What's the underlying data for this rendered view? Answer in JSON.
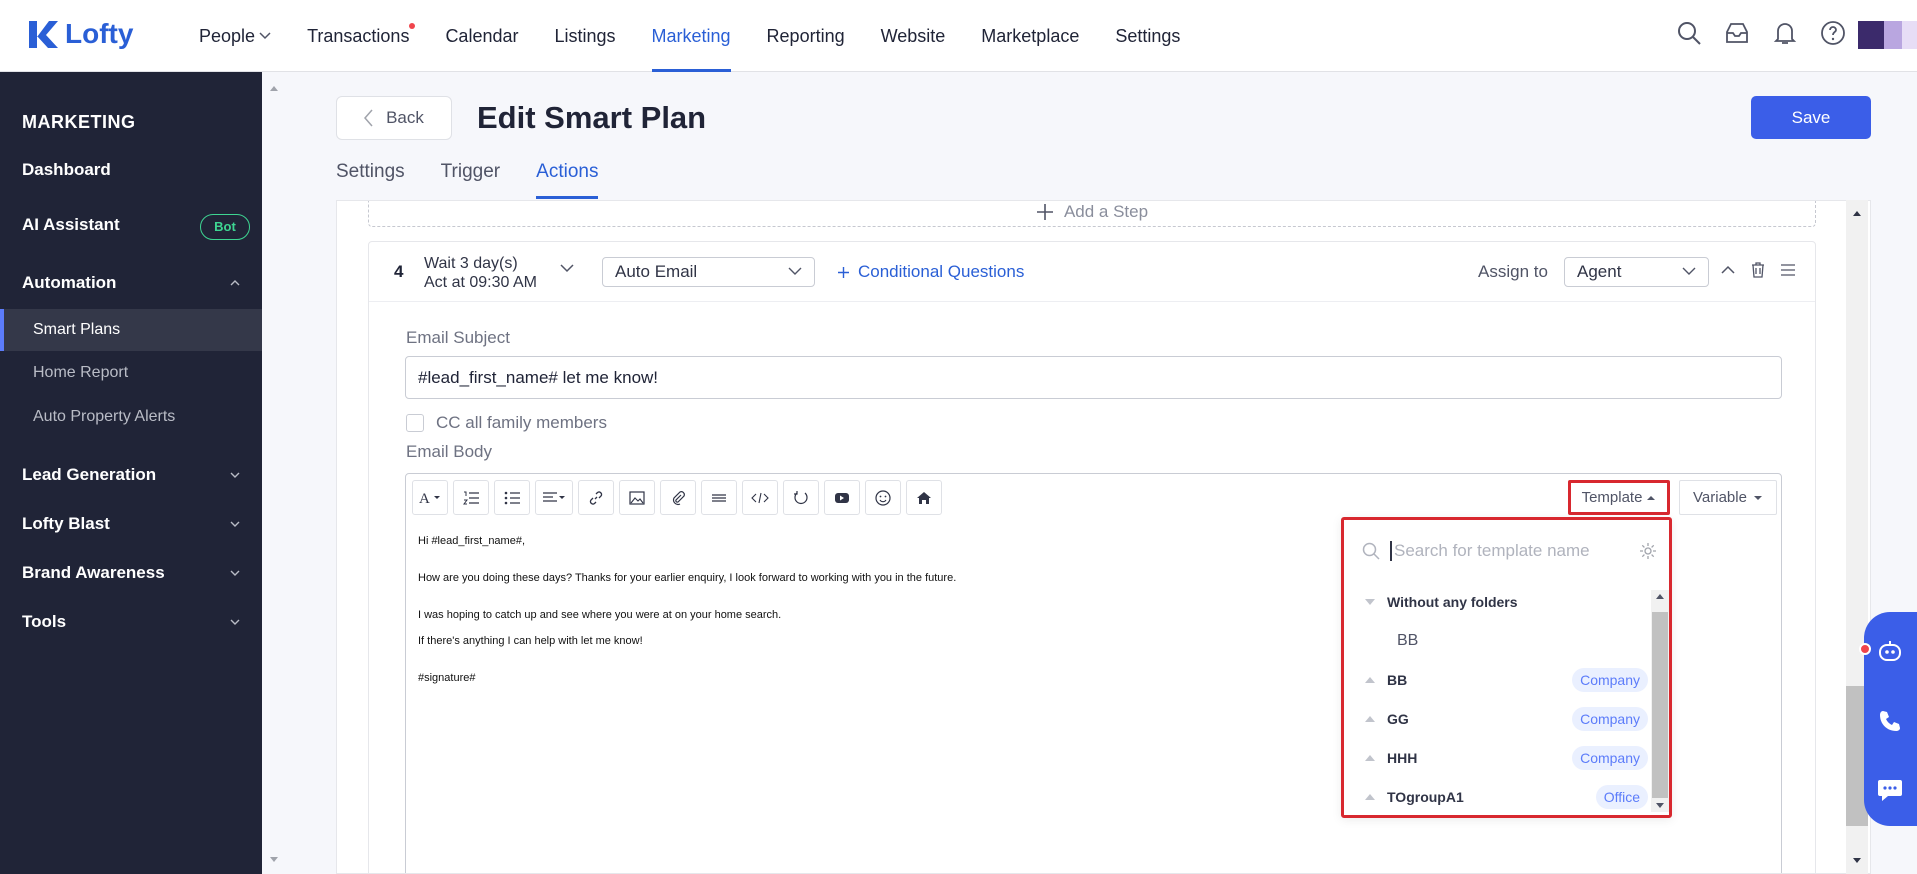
{
  "app": {
    "brand": "Lofty"
  },
  "topnav": {
    "items": [
      "People",
      "Transactions",
      "Calendar",
      "Listings",
      "Marketing",
      "Reporting",
      "Website",
      "Marketplace",
      "Settings"
    ],
    "active": "Marketing"
  },
  "sidebar": {
    "title": "MARKETING",
    "dashboard": "Dashboard",
    "ai_assistant": "AI Assistant",
    "ai_badge": "Bot",
    "automation": "Automation",
    "smart_plans": "Smart Plans",
    "home_report": "Home Report",
    "auto_property_alerts": "Auto Property Alerts",
    "lead_generation": "Lead Generation",
    "lofty_blast": "Lofty Blast",
    "brand_awareness": "Brand Awareness",
    "tools": "Tools"
  },
  "page": {
    "back_label": "Back",
    "title": "Edit Smart Plan",
    "save_label": "Save",
    "tabs": [
      "Settings",
      "Trigger",
      "Actions"
    ],
    "active_tab": "Actions"
  },
  "step": {
    "add_step": "Add a Step",
    "number": "4",
    "wait": "Wait 3 day(s)",
    "act_at": "Act at 09:30 AM",
    "action_type": "Auto Email",
    "conditional": "Conditional Questions",
    "assign_label": "Assign to",
    "assign_value": "Agent",
    "subject_label": "Email Subject",
    "subject_value": "#lead_first_name# let me know!",
    "cc_label": "CC all family members",
    "body_label": "Email Body",
    "body_lines": [
      "Hi #lead_first_name#,",
      "How are you doing these days? Thanks for your earlier enquiry, I look forward to working with you in the future.",
      "I was hoping to catch up and see where you were at on your home search.",
      "If there's anything I can help with let me know!",
      "#signature#"
    ],
    "template_label": "Template",
    "variable_label": "Variable"
  },
  "template_dropdown": {
    "search_placeholder": "Search for template name",
    "folders": [
      {
        "name": "Without any folders",
        "expanded": true,
        "children": [
          "BB"
        ],
        "badge": ""
      },
      {
        "name": "BB",
        "expanded": false,
        "badge": "Company"
      },
      {
        "name": "GG",
        "expanded": false,
        "badge": "Company"
      },
      {
        "name": "HHH",
        "expanded": false,
        "badge": "Company"
      },
      {
        "name": "TOgroupA1",
        "expanded": false,
        "badge": "Office"
      }
    ]
  },
  "colors": {
    "brand": "#2a5fd6",
    "primary_button": "#3b5ee8",
    "sidebar_bg": "#202437",
    "highlight_border": "#d8282f",
    "bot_badge": "#3ed592"
  }
}
